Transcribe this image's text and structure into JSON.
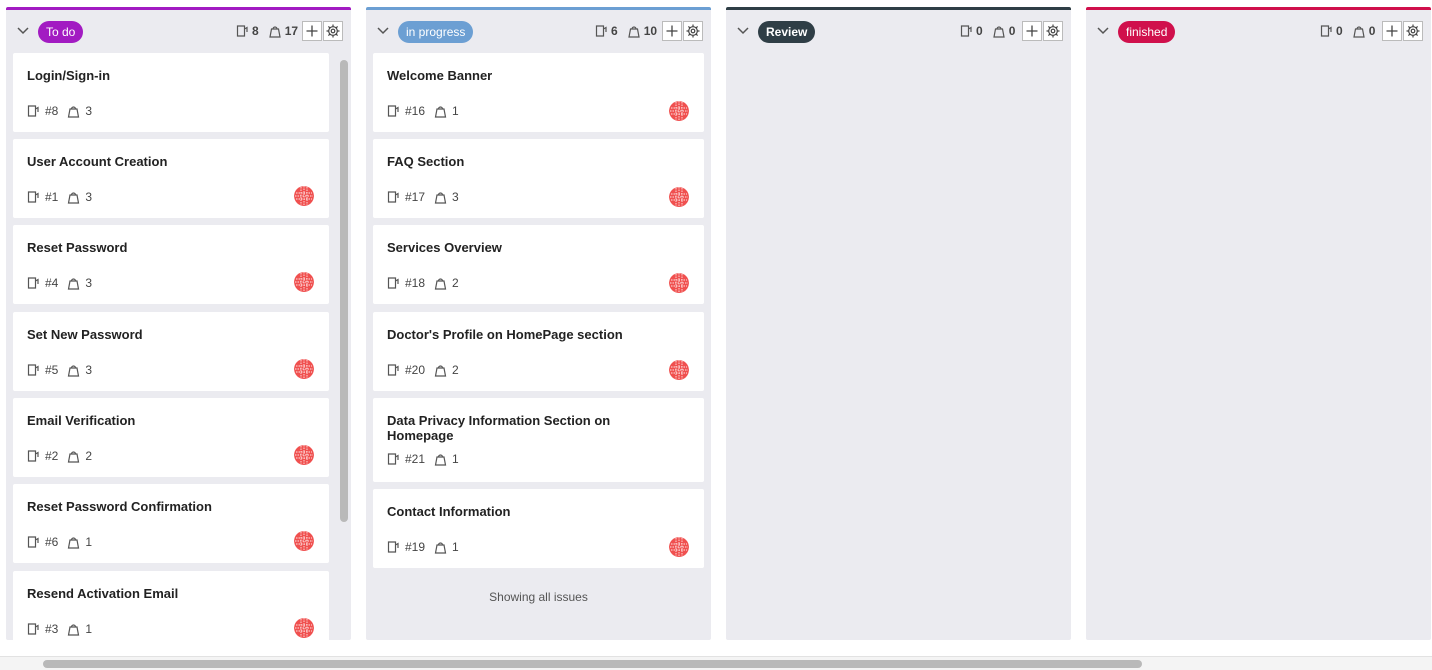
{
  "colors": {
    "todo": "#a21bc2",
    "in_progress": "#6c9fd3",
    "review": "#2f3e46",
    "finished": "#d0104c",
    "avatar": "#f0504f"
  },
  "icons": {
    "collapse": "chevron-down-icon",
    "issues": "issue-icon",
    "points": "weight-icon",
    "add": "plus-icon",
    "settings": "gear-icon",
    "assignee": "avatar"
  },
  "columns": [
    {
      "label": "To do",
      "issue_count": "8",
      "point_count": "17",
      "cards": [
        {
          "title": "Login/Sign-in",
          "issue": "#8",
          "points": "3",
          "assigned": false
        },
        {
          "title": "User Account Creation",
          "issue": "#1",
          "points": "3",
          "assigned": true
        },
        {
          "title": "Reset Password",
          "issue": "#4",
          "points": "3",
          "assigned": true
        },
        {
          "title": "Set New Password",
          "issue": "#5",
          "points": "3",
          "assigned": true
        },
        {
          "title": "Email Verification",
          "issue": "#2",
          "points": "2",
          "assigned": true
        },
        {
          "title": "Reset Password Confirmation",
          "issue": "#6",
          "points": "1",
          "assigned": true
        },
        {
          "title": "Resend Activation Email",
          "issue": "#3",
          "points": "1",
          "assigned": true
        }
      ]
    },
    {
      "label": "in progress",
      "issue_count": "6",
      "point_count": "10",
      "cards": [
        {
          "title": "Welcome Banner",
          "issue": "#16",
          "points": "1",
          "assigned": true
        },
        {
          "title": "FAQ Section",
          "issue": "#17",
          "points": "3",
          "assigned": true
        },
        {
          "title": "Services Overview",
          "issue": "#18",
          "points": "2",
          "assigned": true
        },
        {
          "title": "Doctor's Profile on HomePage section",
          "issue": "#20",
          "points": "2",
          "assigned": true
        },
        {
          "title": "Data Privacy Information Section on Homepage",
          "issue": "#21",
          "points": "1",
          "assigned": false
        },
        {
          "title": "Contact Information",
          "issue": "#19",
          "points": "1",
          "assigned": true
        }
      ],
      "footer": "Showing all issues"
    },
    {
      "label": "Review",
      "issue_count": "0",
      "point_count": "0",
      "cards": []
    },
    {
      "label": "finished",
      "issue_count": "0",
      "point_count": "0",
      "cards": []
    }
  ]
}
